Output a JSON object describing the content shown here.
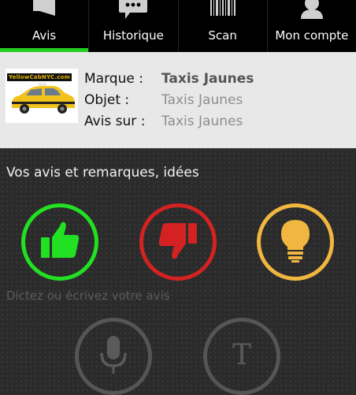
{
  "tabs": [
    {
      "label": "Avis",
      "icon": "megaphone-icon",
      "active": true
    },
    {
      "label": "Historique",
      "icon": "chat-bubble-icon",
      "active": false
    },
    {
      "label": "Scan",
      "icon": "barcode-icon",
      "active": false
    },
    {
      "label": "Mon compte",
      "icon": "person-icon",
      "active": false
    }
  ],
  "product": {
    "logo_text": "YellowCabNYC.com",
    "marque_label": "Marque :",
    "marque_value": "Taxis Jaunes",
    "objet_label": "Objet :",
    "objet_value": "Taxis Jaunes",
    "avis_sur_label": "Avis sur :",
    "avis_sur_value": "Taxis Jaunes"
  },
  "feedback": {
    "title": "Vos avis et remarques, idées",
    "buttons": [
      {
        "name": "like",
        "icon": "thumbs-up-icon",
        "color": "#22e022"
      },
      {
        "name": "dislike",
        "icon": "thumbs-down-icon",
        "color": "#d42222"
      },
      {
        "name": "idea",
        "icon": "lightbulb-icon",
        "color": "#f0b640"
      }
    ]
  },
  "input": {
    "hint": "Dictez ou écrivez votre avis",
    "text_button_glyph": "T"
  },
  "colors": {
    "accent": "#22cc22",
    "muted": "#555555"
  }
}
